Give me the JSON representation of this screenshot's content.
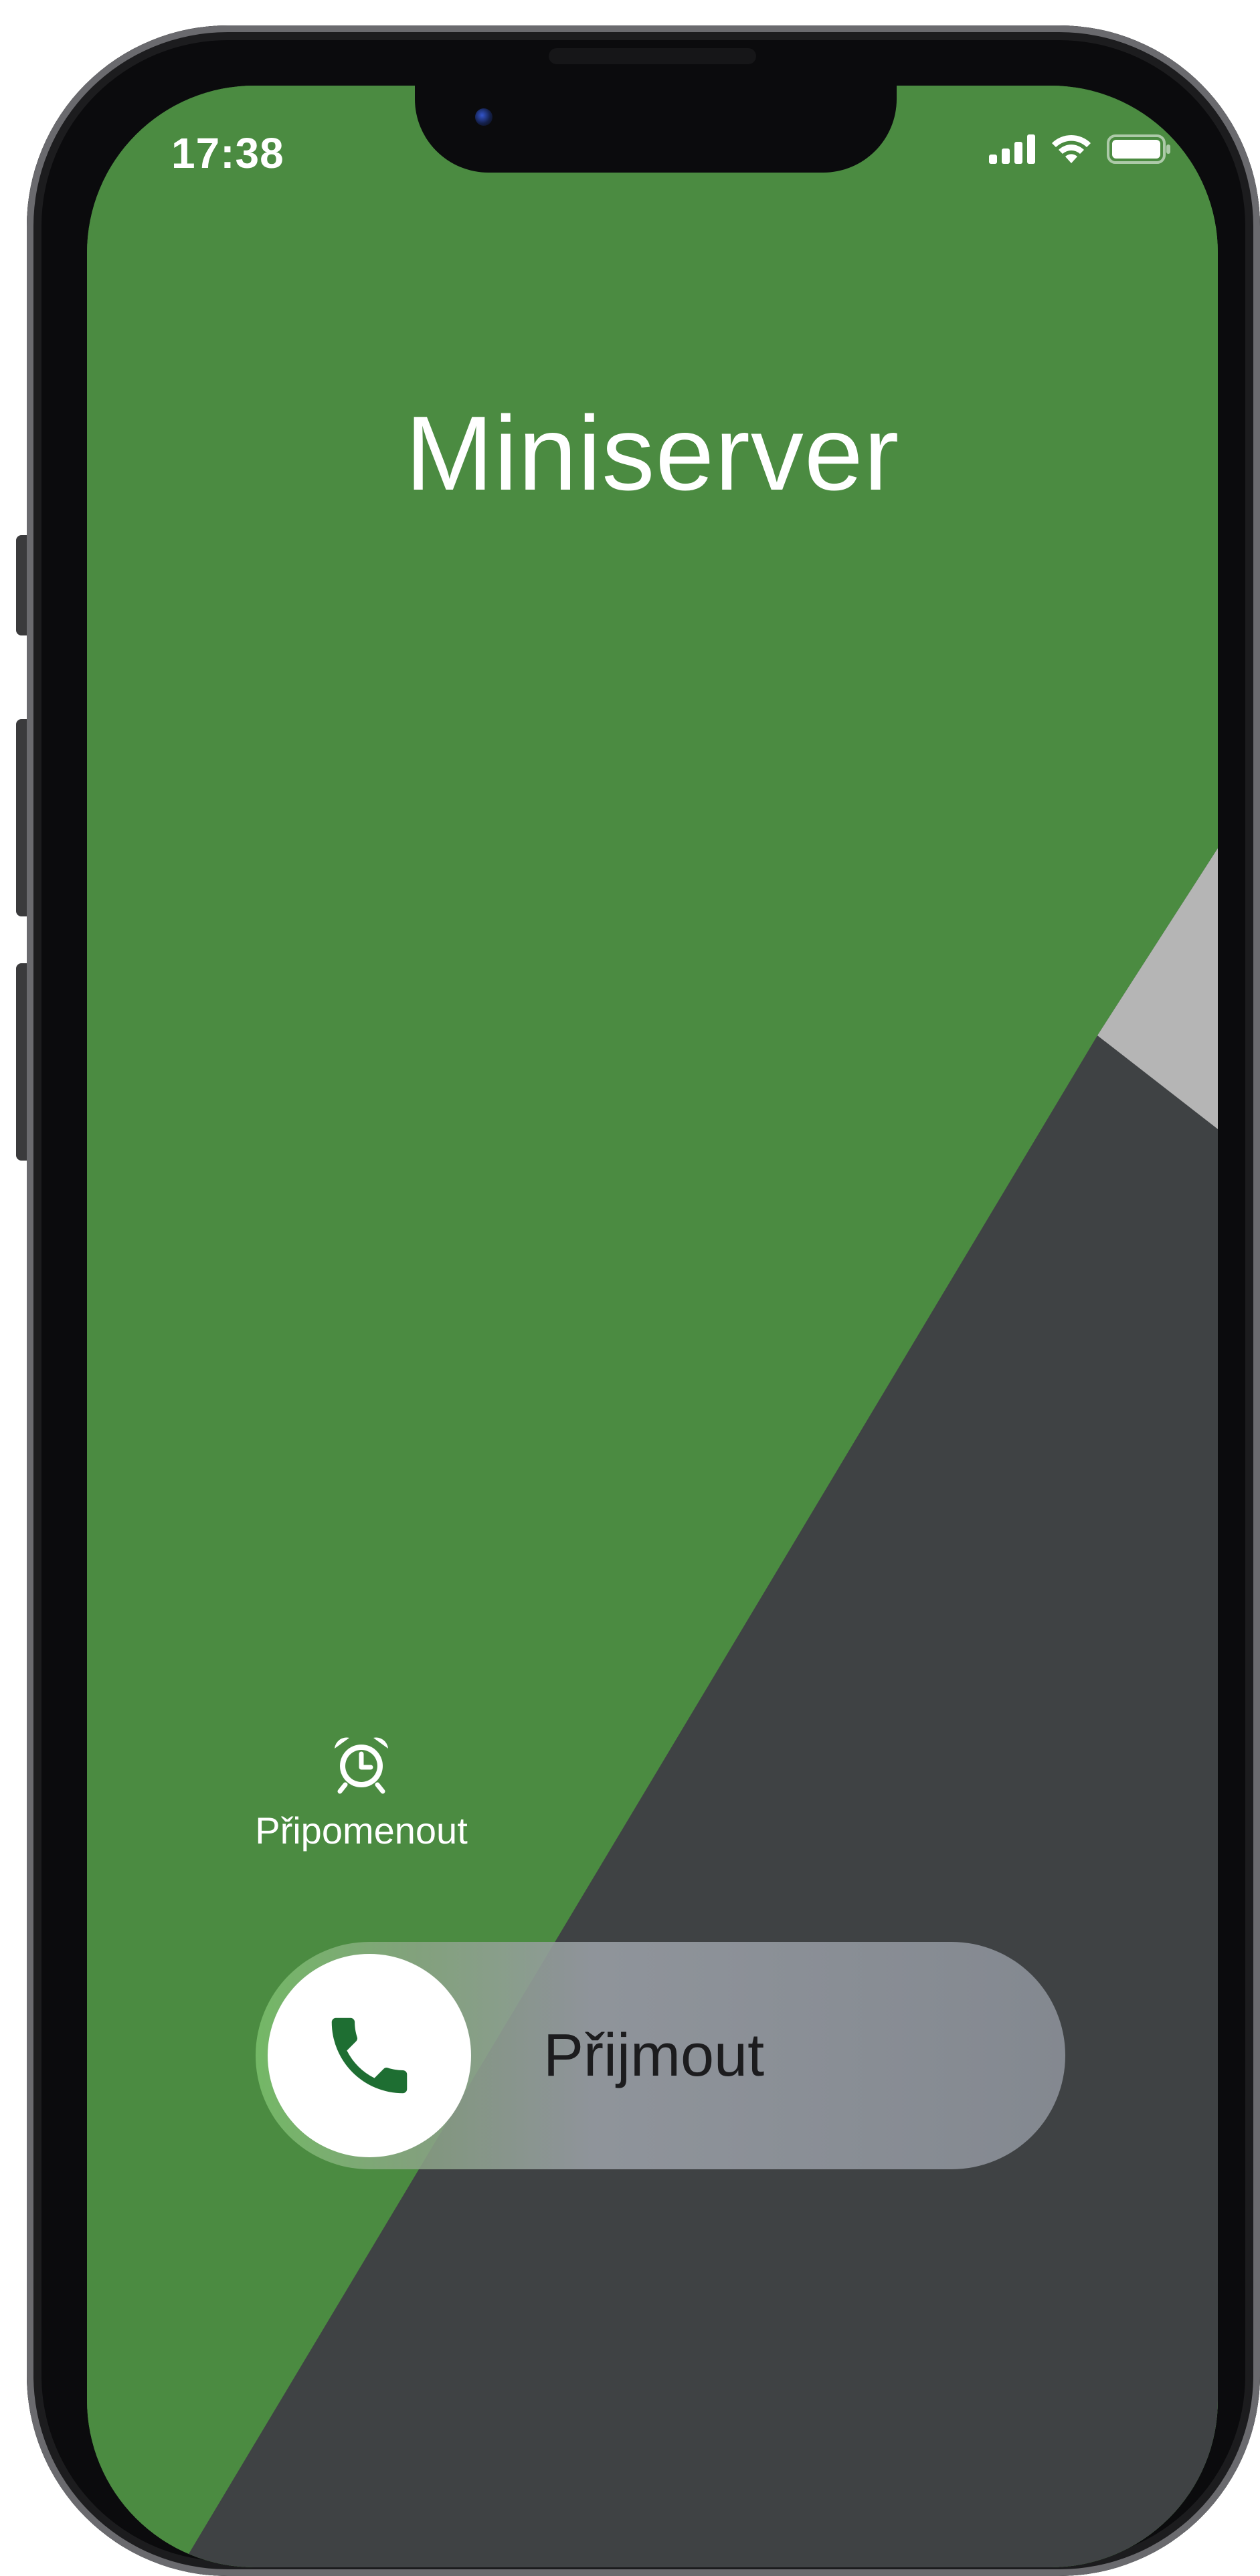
{
  "status_bar": {
    "time": "17:38",
    "icons": [
      "cellular-signal-icon",
      "wifi-icon",
      "battery-icon"
    ]
  },
  "call": {
    "caller_name": "Miniserver"
  },
  "actions": {
    "remind_me": {
      "label": "Připomenout",
      "icon": "alarm-clock-icon"
    }
  },
  "answer_slider": {
    "label": "Přijmout",
    "icon": "phone-icon"
  },
  "colors": {
    "wallpaper_green": "#4b8b41",
    "wallpaper_dark": "#3f4244",
    "wallpaper_grey": "#b5b5b5",
    "phone_icon_green": "#1e6e32"
  }
}
